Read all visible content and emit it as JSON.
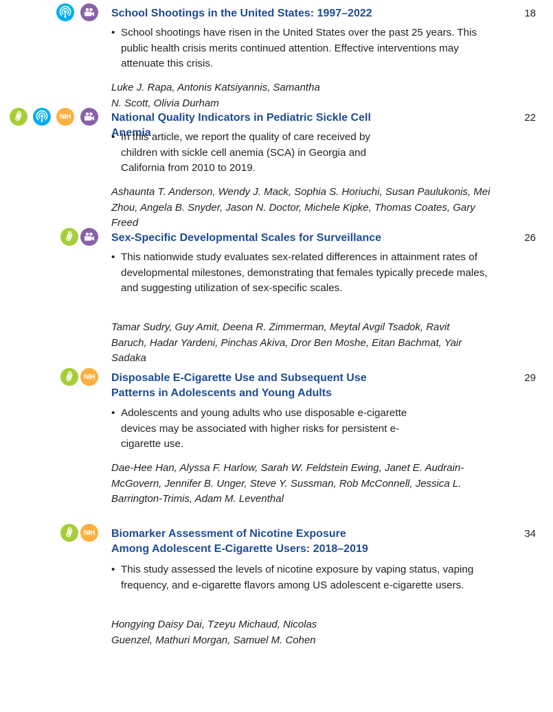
{
  "entries": [
    {
      "title": "School Shootings in the United States: 1997–2022",
      "page": "18",
      "summary": "School shootings have risen in the United States over the past 25 years. This public health crisis merits continued attention. Effective interventions may attenuate this crisis.",
      "authors": "Luke J. Rapa, Antonis Katsiyannis, Samantha N. Scott, Olivia Durham",
      "icons": [
        "podcast-icon",
        "video-icon"
      ]
    },
    {
      "title": "National Quality Indicators in Pediatric Sickle Cell Anemia",
      "page": "22",
      "summary": "In this article, we report the quality of care received by children with sickle cell anemia (SCA) in Georgia and California from 2010 to 2019.",
      "authors": "Ashaunta T. Anderson, Wendy J. Mack, Sophia S. Horiuchi, Susan Paulukonis, Mei Zhou, Angela B. Snyder, Jason N. Doctor, Michele Kipke, Thomas Coates, Gary Freed",
      "icons": [
        "paperclip-icon",
        "podcast-icon",
        "nih-icon",
        "video-icon"
      ]
    },
    {
      "title": "Sex-Specific Developmental Scales for Surveillance",
      "page": "26",
      "summary": "This nationwide study evaluates sex-related differences in attainment rates of developmental milestones, demonstrating that females typically precede males, and suggesting utilization of sex-specific scales.",
      "authors": "Tamar Sudry, Guy Amit, Deena R. Zimmerman, Meytal Avgil Tsadok, Ravit Baruch, Hadar Yardeni, Pinchas Akiva, Dror Ben Moshe, Eitan Bachmat, Yair Sadaka",
      "icons": [
        "paperclip-icon",
        "video-icon"
      ]
    },
    {
      "title": "Disposable E-Cigarette Use and Subsequent Use Patterns in Adolescents and Young Adults",
      "page": "29",
      "summary": "Adolescents and young adults who use disposable e-cigarette devices may be associated with higher risks for persistent e-cigarette use.",
      "authors": "Dae-Hee Han, Alyssa F. Harlow, Sarah W. Feldstein Ewing, Janet E. Audrain-McGovern, Jennifer B. Unger, Steve Y. Sussman, Rob McConnell, Jessica L. Barrington-Trimis, Adam M. Leventhal",
      "icons": [
        "paperclip-icon",
        "nih-icon"
      ]
    },
    {
      "title": "Biomarker Assessment of Nicotine Exposure Among Adolescent E-Cigarette Users: 2018–2019",
      "page": "34",
      "summary": "This study assessed the levels of nicotine exposure by vaping status, vaping frequency, and e-cigarette flavors among US adolescent e-cigarette users.",
      "authors": "Hongying Daisy Dai, Tzeyu Michaud, Nicolas Guenzel, Mathuri Morgan, Samuel M. Cohen",
      "icons": [
        "paperclip-icon",
        "nih-icon"
      ]
    }
  ],
  "bullet": "•",
  "nih_label": "NIH",
  "colors": {
    "title": "#1f4b92",
    "text": "#231f20",
    "paperclip": "#a6ce39",
    "podcast": "#00aeef",
    "video": "#8a61a8",
    "nih": "#fbb040"
  }
}
